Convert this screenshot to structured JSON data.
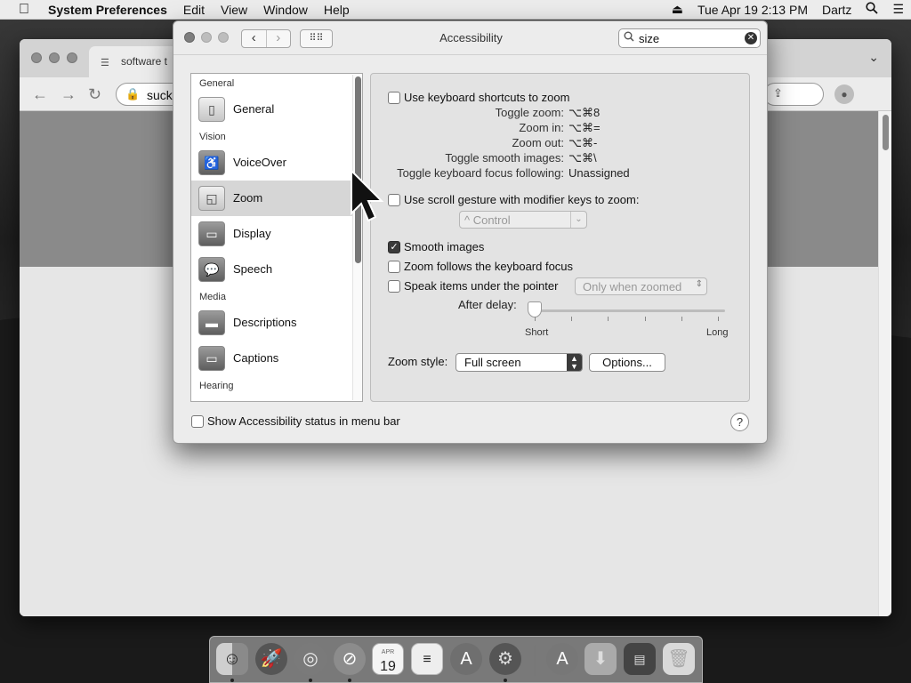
{
  "menubar": {
    "app_name": "System Preferences",
    "menus": [
      "Edit",
      "View",
      "Window",
      "Help"
    ],
    "datetime": "Tue Apr 19  2:13 PM",
    "user": "Dartz"
  },
  "browser": {
    "tab_title": "software t",
    "url_fragment": "suck"
  },
  "prefs": {
    "window_title": "Accessibility",
    "search_value": "size",
    "sidebar": {
      "sections": [
        {
          "header": "General",
          "items": [
            {
              "label": "General",
              "icon": "switch-icon"
            }
          ]
        },
        {
          "header": "Vision",
          "items": [
            {
              "label": "VoiceOver",
              "icon": "voiceover-icon"
            },
            {
              "label": "Zoom",
              "icon": "zoom-icon",
              "selected": true
            },
            {
              "label": "Display",
              "icon": "display-icon"
            },
            {
              "label": "Speech",
              "icon": "speech-icon"
            }
          ]
        },
        {
          "header": "Media",
          "items": [
            {
              "label": "Descriptions",
              "icon": "descriptions-icon"
            },
            {
              "label": "Captions",
              "icon": "captions-icon"
            }
          ]
        },
        {
          "header": "Hearing",
          "items": []
        }
      ]
    },
    "zoom": {
      "keyboard_shortcuts_label": "Use keyboard shortcuts to zoom",
      "keyboard_shortcuts_checked": false,
      "shortcuts": [
        {
          "key": "Toggle zoom:",
          "value": "⌥⌘8"
        },
        {
          "key": "Zoom in:",
          "value": "⌥⌘="
        },
        {
          "key": "Zoom out:",
          "value": "⌥⌘-"
        },
        {
          "key": "Toggle smooth images:",
          "value": "⌥⌘\\"
        },
        {
          "key": "Toggle keyboard focus following:",
          "value": "Unassigned"
        }
      ],
      "scroll_gesture_label": "Use scroll gesture with modifier keys to zoom:",
      "scroll_gesture_checked": false,
      "modifier_value": "^ Control",
      "smooth_images_label": "Smooth images",
      "smooth_images_checked": true,
      "follow_focus_label": "Zoom follows the keyboard focus",
      "follow_focus_checked": false,
      "speak_items_label": "Speak items under the pointer",
      "speak_items_checked": false,
      "speak_items_option": "Only when zoomed",
      "after_delay_label": "After delay:",
      "delay_value": 0,
      "slider_min_label": "Short",
      "slider_max_label": "Long",
      "zoom_style_label": "Zoom style:",
      "zoom_style_value": "Full screen",
      "options_button": "Options..."
    },
    "show_status_label": "Show Accessibility status in menu bar",
    "show_status_checked": false,
    "help_label": "?"
  },
  "dock": {
    "calendar_month": "APR",
    "calendar_day": "19"
  },
  "colors": {
    "selection": "#d6d6d6",
    "checkbox_on": "#3b3b3b"
  }
}
